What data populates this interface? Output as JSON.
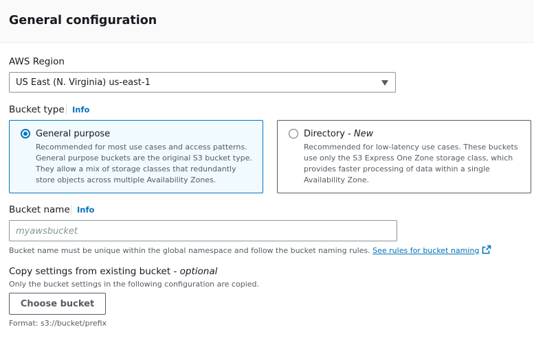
{
  "header": {
    "title": "General configuration"
  },
  "region": {
    "label": "AWS Region",
    "selected": "US East (N. Virginia) us-east-1"
  },
  "bucket_type": {
    "label": "Bucket type",
    "info": "Info",
    "options": [
      {
        "title": "General purpose",
        "title_suffix": "",
        "selected": true,
        "description": "Recommended for most use cases and access patterns. General purpose buckets are the original S3 bucket type. They allow a mix of storage classes that redundantly store objects across multiple Availability Zones."
      },
      {
        "title": "Directory - ",
        "title_suffix": "New",
        "selected": false,
        "description": "Recommended for low-latency use cases. These buckets use only the S3 Express One Zone storage class, which provides faster processing of data within a single Availability Zone."
      }
    ]
  },
  "bucket_name": {
    "label": "Bucket name",
    "info": "Info",
    "placeholder": "myawsbucket",
    "hint": "Bucket name must be unique within the global namespace and follow the bucket naming rules.",
    "rules_link": "See rules for bucket naming"
  },
  "copy_settings": {
    "label": "Copy settings from existing bucket - ",
    "label_optional": "optional",
    "description": "Only the bucket settings in the following configuration are copied.",
    "button": "Choose bucket",
    "format": "Format: s3://bucket/prefix"
  },
  "colors": {
    "accent": "#0073bb",
    "text": "#16191f",
    "secondary_text": "#545b64",
    "selected_tile_bg": "#f1faff"
  },
  "icons": {
    "select_caret": "caret-down-icon",
    "external_link": "external-link-icon"
  }
}
